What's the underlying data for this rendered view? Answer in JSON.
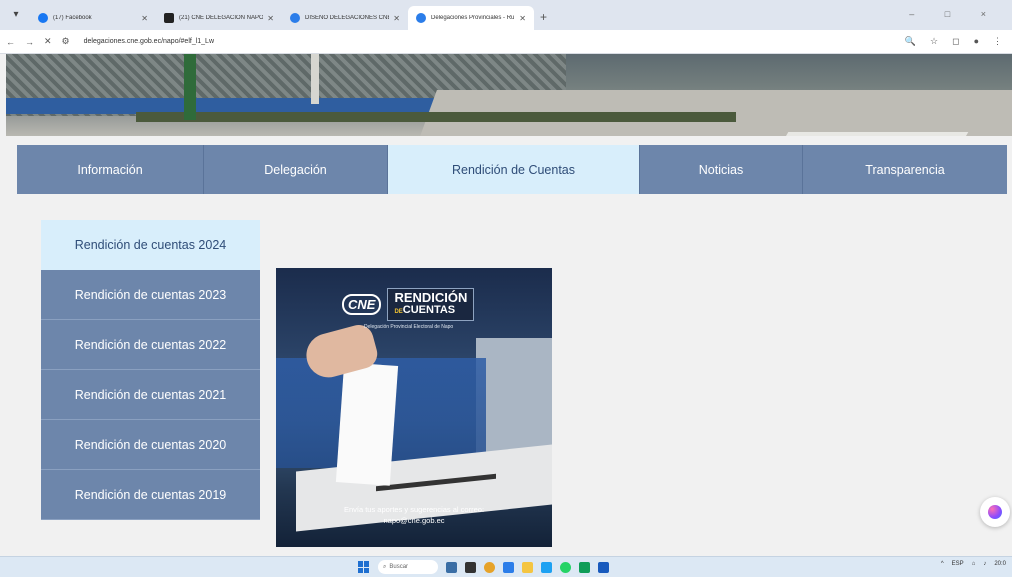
{
  "browser": {
    "tabs": [
      {
        "label": "(17) Facebook",
        "color": "#1877f2",
        "active": false
      },
      {
        "label": "(21) CNE DELEGACION NAPO - ",
        "color": "#222222",
        "active": false
      },
      {
        "label": "DISEÑO DELEGACIONES CNE",
        "color": "#2b7de9",
        "active": false
      },
      {
        "label": "Delegaciones Provinciales - Ru",
        "color": "#2b7de9",
        "active": true
      }
    ],
    "new_tab": "+",
    "url": "delegaciones.cne.gob.ec/napo/#elf_l1_Lw",
    "window_controls": "– □ ×"
  },
  "nav": {
    "items": [
      {
        "label": "Información",
        "active": false
      },
      {
        "label": "Delegación",
        "active": false
      },
      {
        "label": "Rendición de Cuentas",
        "active": true
      },
      {
        "label": "Noticias",
        "active": false
      },
      {
        "label": "Transparencia",
        "active": false
      }
    ]
  },
  "sidebar": {
    "items": [
      {
        "label": "Rendición de cuentas 2024",
        "active": true
      },
      {
        "label": "Rendición de cuentas 2023",
        "active": false
      },
      {
        "label": "Rendición de cuentas 2022",
        "active": false
      },
      {
        "label": "Rendición de cuentas 2021",
        "active": false
      },
      {
        "label": "Rendición de cuentas 2020",
        "active": false
      },
      {
        "label": "Rendición de cuentas 2019",
        "active": false
      }
    ]
  },
  "poster": {
    "logo": "CNE",
    "title_line1": "RENDICIÓN",
    "title_de": "DE",
    "title_line2": "CUENTAS",
    "subtitle": "Delegación Provincial Electoral de Napo",
    "message_line1": "Envía tus aportes y sugerencias al correo:",
    "message_line2": "napo@cne.gob.ec"
  },
  "taskbar": {
    "search_placeholder": "Buscar",
    "lang": "ESP",
    "time": "20:0"
  },
  "colors": {
    "nav_bg": "#6d86ab",
    "nav_active_bg": "#d8eefb",
    "nav_active_text": "#2f4d78"
  }
}
